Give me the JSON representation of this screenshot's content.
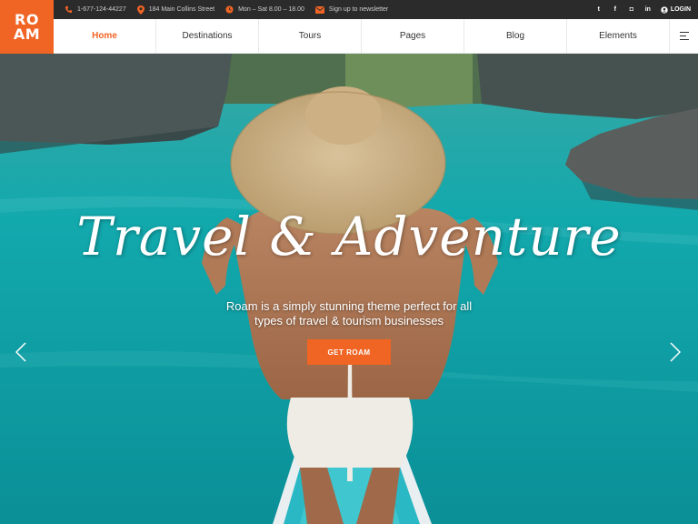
{
  "brand": {
    "logo_line1": "RO",
    "logo_line2": "AM",
    "accent_color": "#f06424"
  },
  "topbar": {
    "phone": "1-677-124-44227",
    "address": "184 Main Collins Street",
    "hours": "Mon – Sat 8.00 – 18.00",
    "newsletter": "Sign up to newsletter",
    "social": [
      "twitter-icon",
      "facebook-icon",
      "instagram-icon",
      "linkedin-icon"
    ],
    "social_glyphs": [
      "t",
      "f",
      "◘",
      "in"
    ],
    "login": "LOGIN"
  },
  "nav": {
    "items": [
      {
        "label": "Home",
        "active": true
      },
      {
        "label": "Destinations"
      },
      {
        "label": "Tours"
      },
      {
        "label": "Pages"
      },
      {
        "label": "Blog"
      },
      {
        "label": "Elements"
      }
    ]
  },
  "hero": {
    "headline": "Travel & Adventure",
    "subtitle": "Roam is a simply stunning theme perfect for all types of travel & tourism businesses",
    "cta": "GET ROAM",
    "water_color": "#1aa3a6"
  }
}
